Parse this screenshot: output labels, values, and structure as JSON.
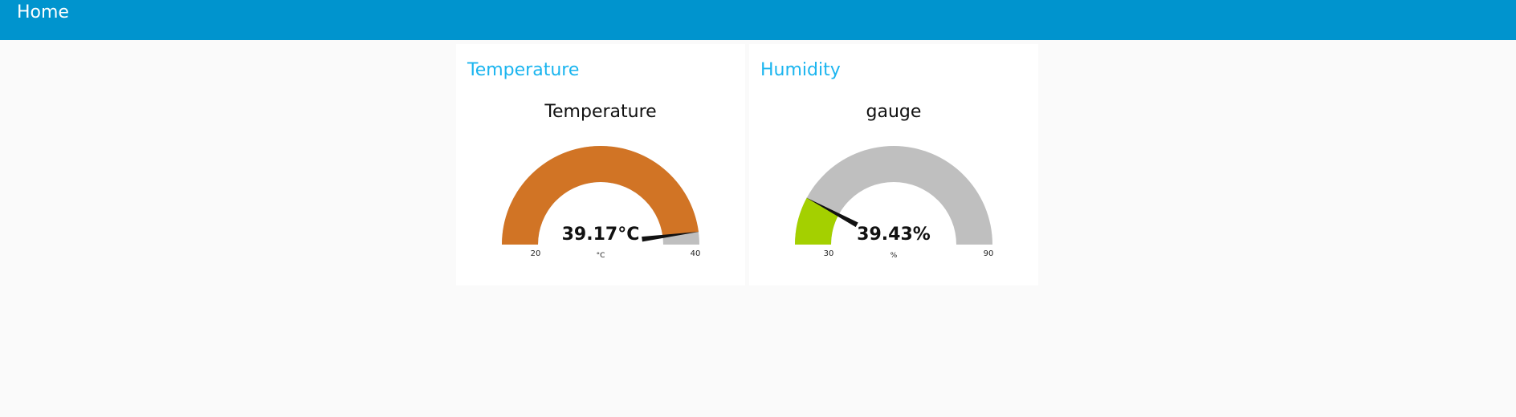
{
  "header": {
    "title": "Home"
  },
  "widgets": [
    {
      "group_title": "Temperature",
      "label": "Temperature",
      "value": 39.17,
      "value_text": "39.17°C",
      "unit": "°C",
      "min": 20,
      "max": 40,
      "min_text": "20",
      "max_text": "40",
      "fill_color": "#d17425",
      "track_color": "#bfbfbf",
      "needle_color": "#111111"
    },
    {
      "group_title": "Humidity",
      "label": "gauge",
      "value": 39.43,
      "value_text": "39.43%",
      "unit": "%",
      "min": 30,
      "max": 90,
      "min_text": "30",
      "max_text": "90",
      "fill_color": "#a4d000",
      "track_color": "#bfbfbf",
      "needle_color": "#111111"
    }
  ],
  "colors": {
    "header_bg": "#0094ce",
    "group_title": "#1bb5ef",
    "page_bg": "#fafafa"
  }
}
